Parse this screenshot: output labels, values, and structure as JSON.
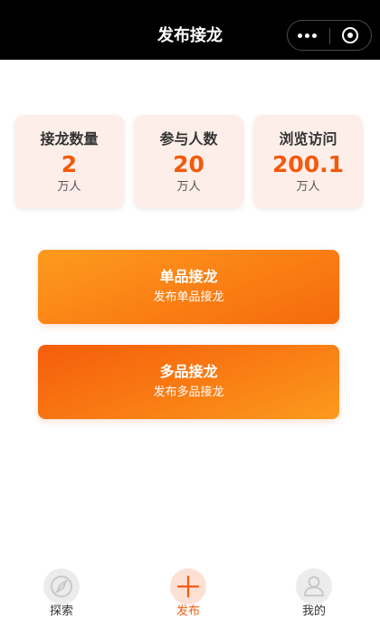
{
  "navbar": {
    "title": "发布接龙",
    "more_icon": "more-dots-icon",
    "close_icon": "target-close-icon"
  },
  "stats": [
    {
      "label": "接龙数量",
      "value": "2",
      "unit": "万人"
    },
    {
      "label": "参与人数",
      "value": "20",
      "unit": "万人"
    },
    {
      "label": "浏览访问",
      "value": "200.1",
      "unit": "万人"
    }
  ],
  "actions": {
    "single": {
      "title": "单品接龙",
      "subtitle": "发布单品接龙"
    },
    "multi": {
      "title": "多品接龙",
      "subtitle": "发布多品接龙"
    }
  },
  "tabbar": {
    "active": "publish",
    "items": [
      {
        "id": "explore",
        "label": "探索",
        "icon": "compass-icon"
      },
      {
        "id": "publish",
        "label": "发布",
        "icon": "plus-icon"
      },
      {
        "id": "mine",
        "label": "我的",
        "icon": "user-icon"
      }
    ]
  },
  "colors": {
    "accent": "#f25a0c",
    "stat_card_bg": "#fdeee9",
    "navbar_bg": "#000000"
  }
}
